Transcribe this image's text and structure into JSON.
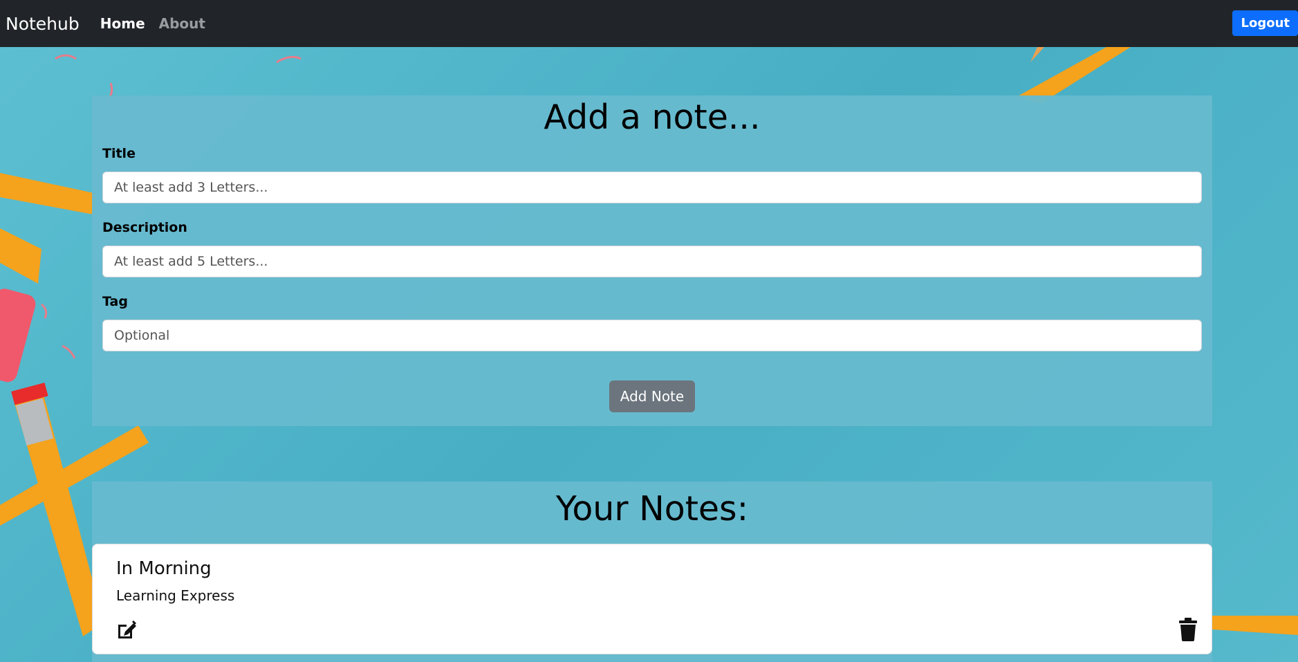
{
  "navbar": {
    "brand": "Notehub",
    "links": [
      {
        "label": "Home"
      },
      {
        "label": "About"
      }
    ],
    "logout_label": "Logout"
  },
  "add_note": {
    "heading": "Add a note...",
    "title_label": "Title",
    "title_placeholder": "At least add 3 Letters...",
    "title_value": "",
    "description_label": "Description",
    "description_placeholder": "At least add 5 Letters...",
    "description_value": "",
    "tag_label": "Tag",
    "tag_placeholder": "Optional",
    "tag_value": "",
    "submit_label": "Add Note"
  },
  "notes": {
    "heading": "Your Notes:",
    "items": [
      {
        "title": "In Morning",
        "description": "Learning Express",
        "edit_icon": "edit-icon",
        "delete_icon": "trash-icon"
      }
    ]
  },
  "colors": {
    "navbar_bg": "#212529",
    "logout_bg": "#0d6efd",
    "panel_bg": "#67bace",
    "add_button_bg": "#6c757d"
  }
}
